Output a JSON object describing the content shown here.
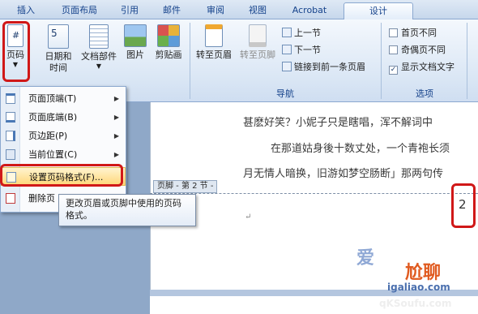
{
  "tabs": [
    "插入",
    "页面布局",
    "引用",
    "邮件",
    "审阅",
    "视图",
    "Acrobat",
    "设计"
  ],
  "ribbon": {
    "page_number_btn": "页码",
    "datetime_btn": [
      "日期和",
      "时间"
    ],
    "docparts_btn": "文档部件",
    "picture_btn": "图片",
    "clipart_btn": "剪贴画",
    "goto_header_btn": "转至页眉",
    "goto_footer_btn": "转至页脚",
    "prev_section": "上一节",
    "next_section": "下一节",
    "link_previous": "链接到前一条页眉",
    "nav_group": "导航",
    "options_group": "选项",
    "opt_first_page": "首页不同",
    "opt_odd_even": "奇偶页不同",
    "opt_show_text": "显示文档文字",
    "opt_show_text_checked": "✓"
  },
  "menu": {
    "items": [
      {
        "label": "页面顶端(T)",
        "icon": "page-top-icon"
      },
      {
        "label": "页面底端(B)",
        "icon": "page-bottom-icon"
      },
      {
        "label": "页边距(P)",
        "icon": "page-margin-icon"
      },
      {
        "label": "当前位置(C)",
        "icon": "current-position-icon"
      },
      {
        "label": "设置页码格式(F)...",
        "icon": "format-page-number-icon"
      },
      {
        "label": "删除页",
        "icon": "delete-page-number-icon"
      }
    ]
  },
  "tooltip": "更改页眉或页脚中使用的页码格式。",
  "document": {
    "lines": [
      "甚麽好笑？小妮子只是瞎唱，浑不解词中",
      "在那道姑身後十数丈处，一个青袍长须",
      "月无情人暗换，旧游如梦空肠断」那两句传"
    ],
    "footer_label": "页脚 - 第 2 节 -",
    "page_number": "2",
    "cursor_mark": "↵"
  },
  "watermark": {
    "text1": "爱",
    "text2": "尬聊",
    "site": "igaliao.com",
    "site2": "qKSoufu.com"
  },
  "colors": {
    "highlight_red": "#d01818",
    "tab_text": "#15428b"
  }
}
